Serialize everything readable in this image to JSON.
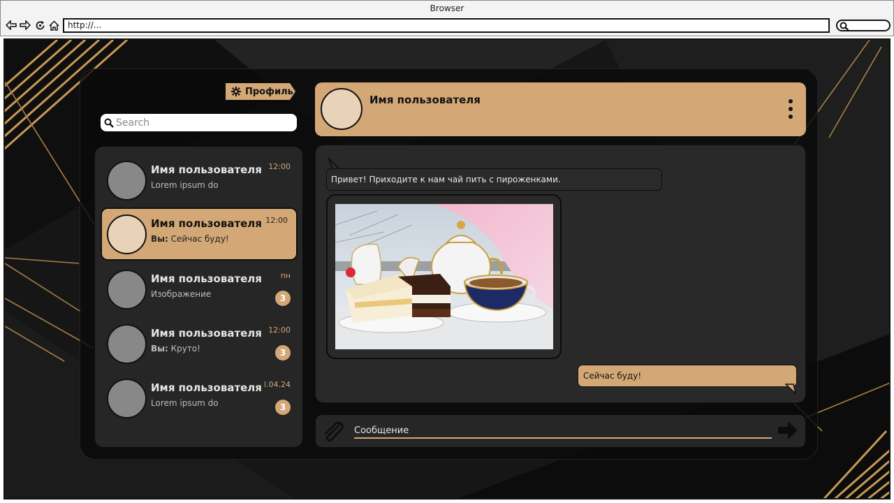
{
  "browser": {
    "title": "Browser",
    "url": "http://..."
  },
  "sidebar": {
    "profile_label": "Профиль",
    "search_placeholder": "Search",
    "chats": [
      {
        "name": "Имя пользователя",
        "prefix": "",
        "preview": "Lorem ipsum do",
        "time": "12:00",
        "unread": ""
      },
      {
        "name": "Имя пользователя",
        "prefix": "Вы:",
        "preview": " Сейчас буду!",
        "time": "12:00",
        "unread": ""
      },
      {
        "name": "Имя пользователя",
        "prefix": "",
        "preview": "Изображение",
        "time": "пн",
        "unread": "3"
      },
      {
        "name": "Имя пользователя",
        "prefix": "Вы:",
        "preview": " Круто!",
        "time": "12:00",
        "unread": "3"
      },
      {
        "name": "Имя пользователя",
        "prefix": "",
        "preview": "Lorem ipsum do",
        "time": "l.04.24",
        "unread": "3"
      }
    ]
  },
  "conversation": {
    "contact_name": "Имя пользователя",
    "messages": {
      "incoming_text": "Привет! Приходите к нам чай пить с пироженками.",
      "outgoing_text": "Сейчас буду!"
    },
    "composer_placeholder": "Сообщение"
  },
  "colors": {
    "accent": "#d4a876",
    "panel": "#262626",
    "background": "#141414"
  }
}
